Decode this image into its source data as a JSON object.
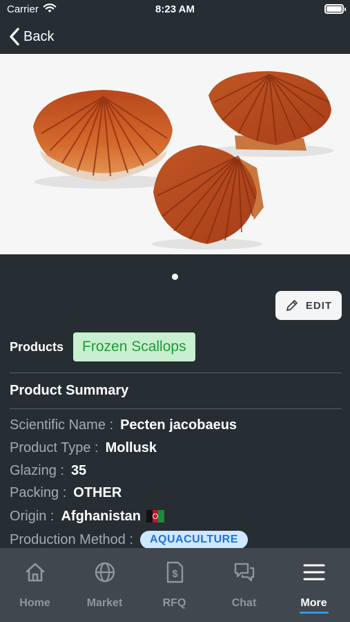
{
  "status_bar": {
    "carrier": "Carrier",
    "time": "8:23 AM"
  },
  "nav": {
    "back_label": "Back"
  },
  "carousel": {
    "page_count": 1,
    "current_page": 1
  },
  "edit_label": "EDIT",
  "products": {
    "label": "Products",
    "value": "Frozen Scallops",
    "chip_bg": "#c8efcf",
    "chip_fg": "#1e9a3a"
  },
  "summary": {
    "title": "Product Summary",
    "scientific_name": {
      "key": "Scientific Name :",
      "value": "Pecten jacobaeus"
    },
    "product_type": {
      "key": "Product Type :",
      "value": "Mollusk"
    },
    "glazing": {
      "key": "Glazing :",
      "value": "35"
    },
    "packing": {
      "key": "Packing :",
      "value": "OTHER"
    },
    "origin": {
      "key": "Origin :",
      "value": "Afghanistan",
      "flag": "afghanistan-flag"
    },
    "production_method": {
      "key": "Production Method :",
      "value": "AQUACULTURE"
    }
  },
  "tabs": [
    {
      "label": "Home",
      "icon": "home-icon"
    },
    {
      "label": "Market",
      "icon": "globe-icon"
    },
    {
      "label": "RFQ",
      "icon": "dollar-document-icon"
    },
    {
      "label": "Chat",
      "icon": "chat-bubbles-icon"
    },
    {
      "label": "More",
      "icon": "menu-icon",
      "active": true
    }
  ],
  "colors": {
    "background": "#262d33",
    "tab_bar": "#40474e",
    "accent": "#2e9be0"
  }
}
